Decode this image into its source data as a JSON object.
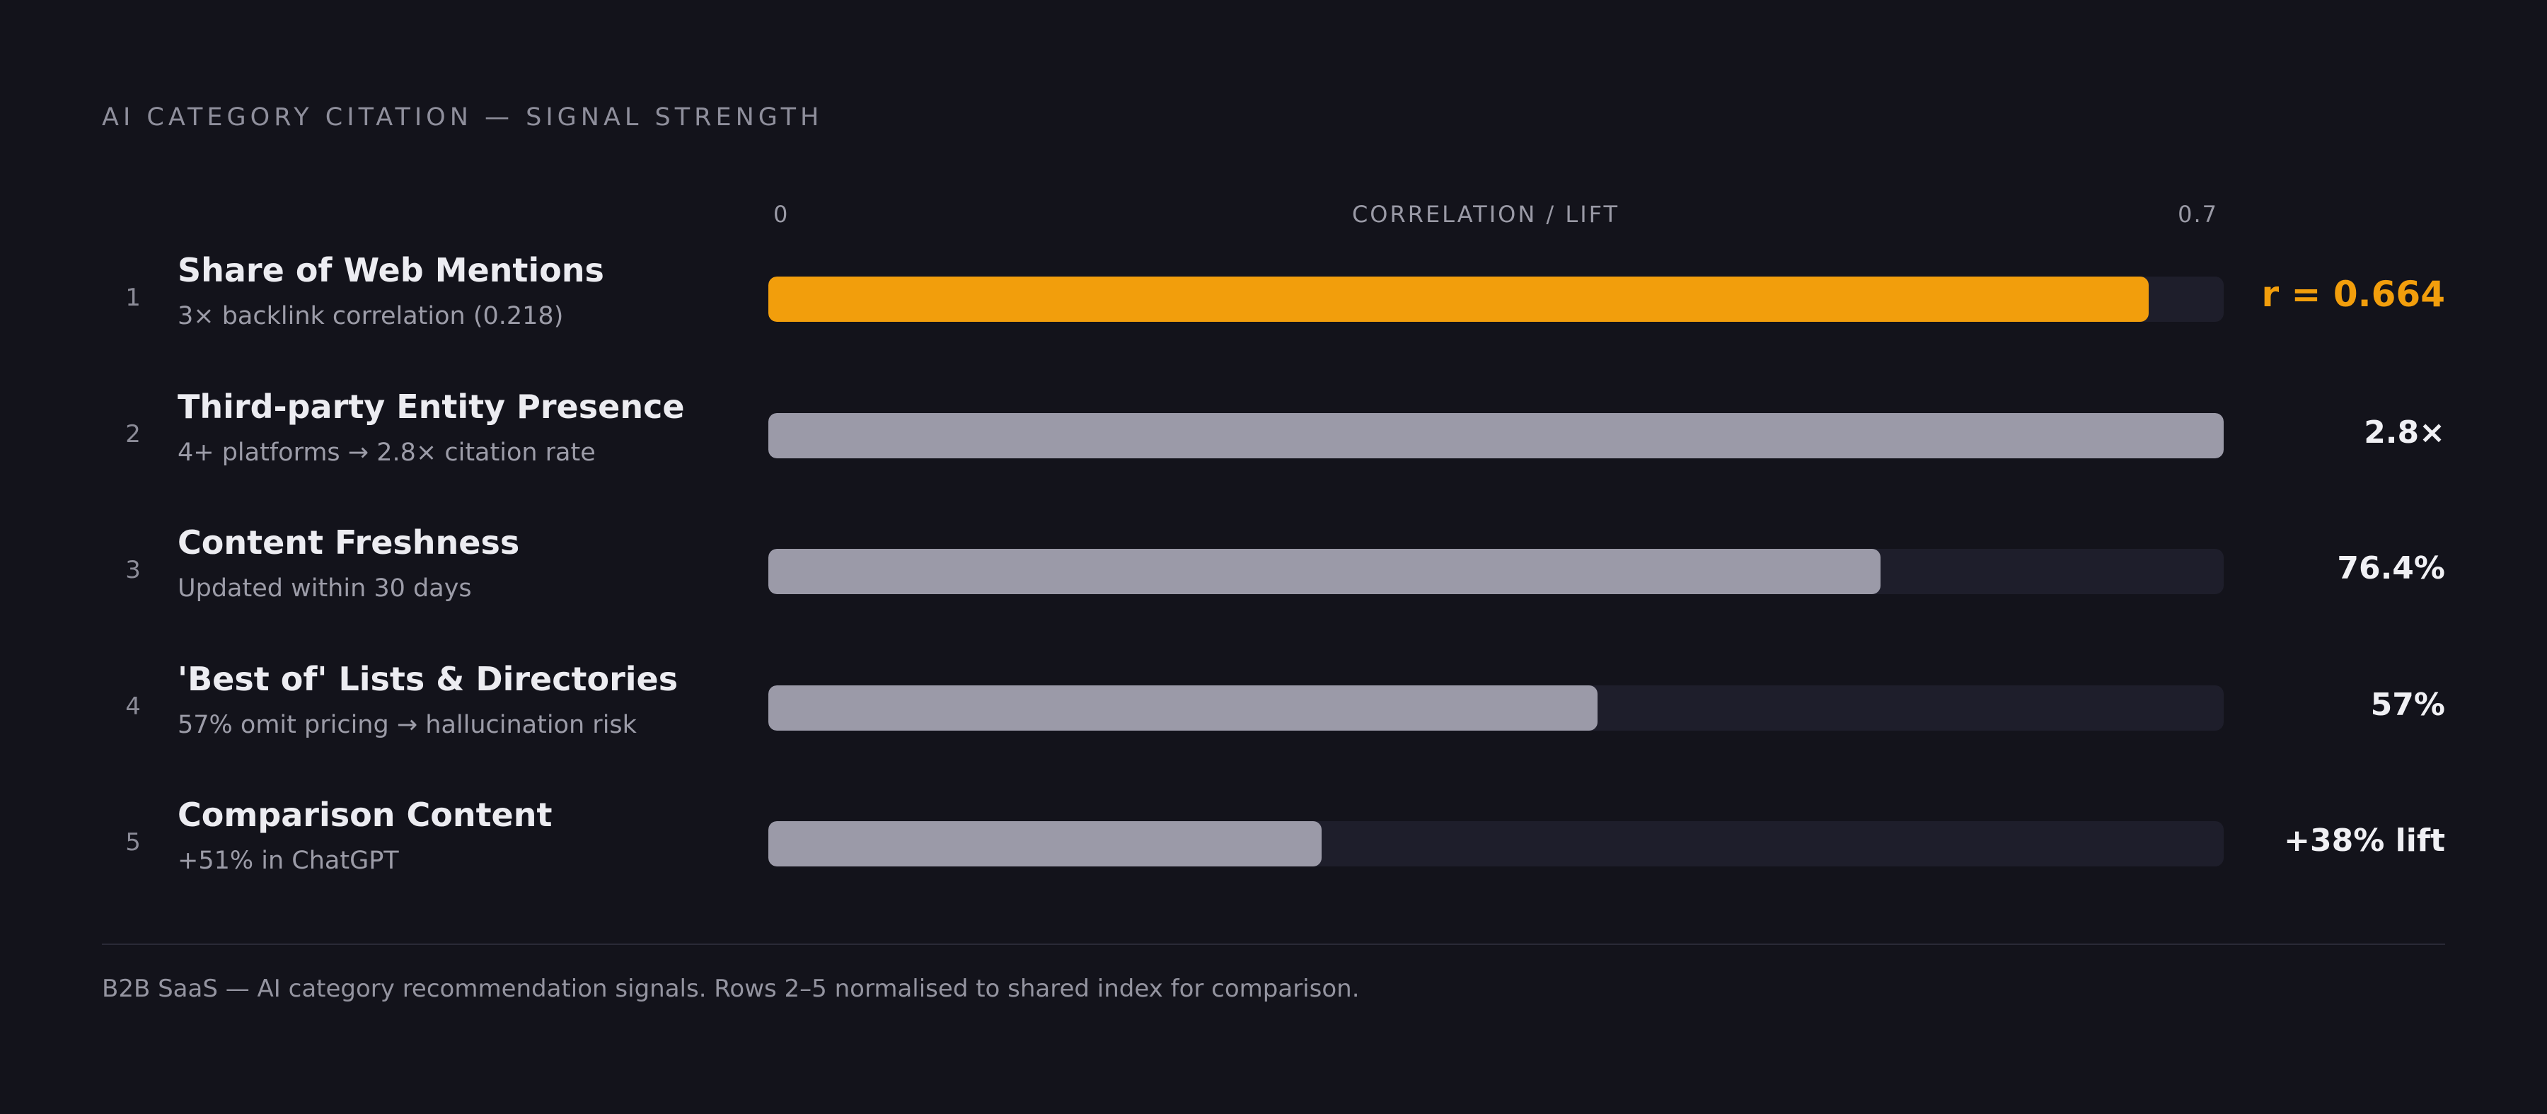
{
  "chart_data": {
    "type": "bar",
    "title": "AI CATEGORY CITATION — SIGNAL STRENGTH",
    "xlabel": "CORRELATION / LIFT",
    "xlim": [
      0,
      0.7
    ],
    "axis_min_label": "0",
    "axis_max_label": "0.7",
    "categories": [
      "Share of Web Mentions",
      "Third-party Entity Presence",
      "Content Freshness",
      "'Best of' Lists & Directories",
      "Comparison Content"
    ],
    "rows": [
      {
        "rank": "1",
        "label": "Share of Web Mentions",
        "subtitle": "3× backlink correlation (0.218)",
        "value": 0.664,
        "value_label": "r = 0.664",
        "highlight": true
      },
      {
        "rank": "2",
        "label": "Third-party Entity Presence",
        "subtitle": "4+ platforms → 2.8× citation rate",
        "value": 0.7,
        "value_label": "2.8×",
        "highlight": false
      },
      {
        "rank": "3",
        "label": "Content Freshness",
        "subtitle": "Updated within 30 days",
        "value": 0.535,
        "value_label": "76.4%",
        "highlight": false
      },
      {
        "rank": "4",
        "label": "'Best of' Lists & Directories",
        "subtitle": "57% omit pricing → hallucination risk",
        "value": 0.399,
        "value_label": "57%",
        "highlight": false
      },
      {
        "rank": "5",
        "label": "Comparison Content",
        "subtitle": "+51% in ChatGPT",
        "value": 0.266,
        "value_label": "+38% lift",
        "highlight": false
      }
    ],
    "footnote": "B2B SaaS — AI category recommendation signals. Rows 2–5 normalised to shared index for comparison.",
    "colors": {
      "background": "#13131b",
      "highlight": "#f29e0c",
      "bar": "#9b9aa8",
      "track": "#1e1e2b"
    },
    "grid": false
  }
}
